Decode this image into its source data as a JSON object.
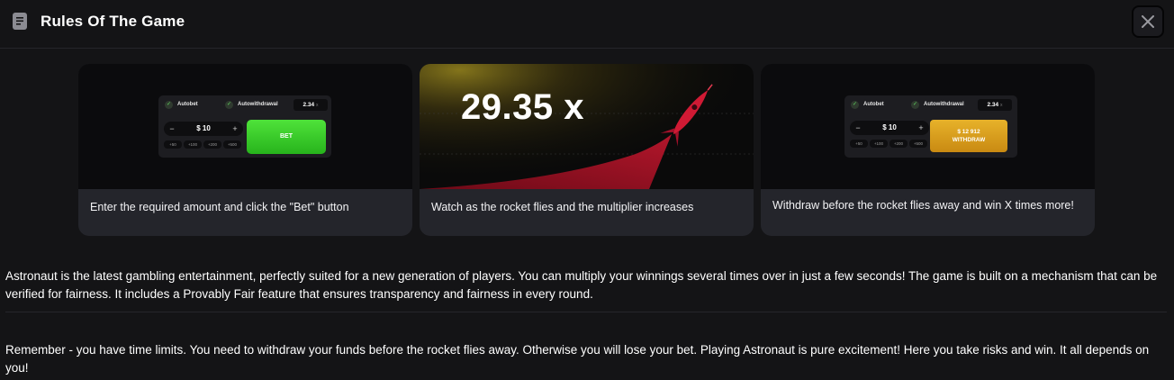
{
  "header": {
    "title": "Rules Of The Game",
    "icon": "document-icon",
    "close_icon": "close-icon"
  },
  "cards": [
    {
      "caption": "Enter the required amount and click the \"Bet\" button",
      "widget": {
        "autobet_label": "Autobet",
        "autowithdrawal_label": "Autowithdrawal",
        "auto_value": "2.34",
        "auto_suffix": "x",
        "amount": "$ 10",
        "minus": "−",
        "plus": "+",
        "chips": [
          "+50",
          "+100",
          "+200",
          "+500"
        ],
        "bet_label": "BET"
      }
    },
    {
      "caption": "Watch as the rocket flies and the multiplier increases",
      "multiplier": "29.35 x"
    },
    {
      "caption": "Withdraw before the rocket flies away and win X times more!",
      "widget": {
        "autobet_label": "Autobet",
        "autowithdrawal_label": "Autowithdrawal",
        "auto_value": "2.34",
        "auto_suffix": "x",
        "amount": "$ 10",
        "minus": "−",
        "plus": "+",
        "chips": [
          "+50",
          "+100",
          "+200",
          "+500"
        ],
        "withdraw_amount": "$ 12 912",
        "withdraw_label": "WITHDRAW"
      }
    }
  ],
  "paragraphs": [
    "Astronaut is the latest gambling entertainment, perfectly suited for a new generation of players. You can multiply your winnings several times over in just a few seconds! The game is built on a mechanism that can be verified for fairness. It includes a Provably Fair feature that ensures transparency and fairness in every round.",
    "Remember - you have time limits. You need to withdraw your funds before the rocket flies away. Otherwise you will lose your bet. Playing Astronaut is pure excitement! Here you take risks and win. It all depends on you!"
  ],
  "colors": {
    "background": "#141416",
    "card": "#24252b",
    "bet_green": "#3ccc2a",
    "withdraw_gold": "#d9a01c",
    "rocket_red": "#c8102e"
  }
}
